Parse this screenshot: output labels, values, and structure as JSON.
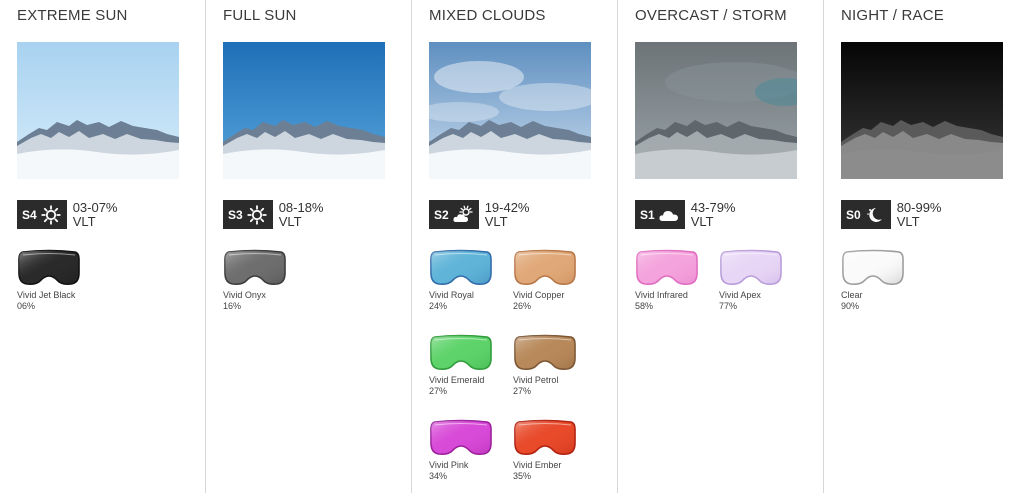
{
  "categories": [
    {
      "title": "EXTREME SUN",
      "code": "S4",
      "icon": "sun-icon",
      "vlt_range": "03-07%",
      "vlt_label": "VLT",
      "sky": [
        "#a8d2f0",
        "#d6ecfa"
      ],
      "lenses": [
        {
          "name": "Vivid Jet Black",
          "vlt": "06%",
          "color": "#2a2a2a",
          "edge": "#111111"
        }
      ]
    },
    {
      "title": "FULL SUN",
      "code": "S3",
      "icon": "sun-icon",
      "vlt_range": "08-18%",
      "vlt_label": "VLT",
      "sky": [
        "#1e6fb8",
        "#5aa6db"
      ],
      "lenses": [
        {
          "name": "Vivid Onyx",
          "vlt": "16%",
          "color": "#6e6e6e",
          "edge": "#3a3a3a"
        }
      ]
    },
    {
      "title": "MIXED CLOUDS",
      "code": "S2",
      "icon": "partly-cloudy-icon",
      "vlt_range": "19-42%",
      "vlt_label": "VLT",
      "sky": [
        "#5f8fc0",
        "#c9dcee"
      ],
      "lenses": [
        {
          "name": "Vivid Royal",
          "vlt": "24%",
          "color": "#5fb4d8",
          "edge": "#2f6aa8"
        },
        {
          "name": "Vivid Copper",
          "vlt": "26%",
          "color": "#e0a878",
          "edge": "#b77545"
        },
        {
          "name": "Vivid Emerald",
          "vlt": "27%",
          "color": "#5ed36a",
          "edge": "#2f9a3a"
        },
        {
          "name": "Vivid Petrol",
          "vlt": "27%",
          "color": "#b8895a",
          "edge": "#7a5533"
        },
        {
          "name": "Vivid Pink",
          "vlt": "34%",
          "color": "#d84ad8",
          "edge": "#9a1f9a"
        },
        {
          "name": "Vivid Ember",
          "vlt": "35%",
          "color": "#e84a2a",
          "edge": "#b02010"
        }
      ]
    },
    {
      "title": "OVERCAST / STORM",
      "code": "S1",
      "icon": "cloud-icon",
      "vlt_range": "43-79%",
      "vlt_label": "VLT",
      "sky": [
        "#6d7478",
        "#9aa4a8"
      ],
      "lenses": [
        {
          "name": "Vivid Infrared",
          "vlt": "58%",
          "color": "#f4a3dc",
          "edge": "#e06ac0"
        },
        {
          "name": "Vivid Apex",
          "vlt": "77%",
          "color": "#e8d6f6",
          "edge": "#b79ad8"
        }
      ]
    },
    {
      "title": "NIGHT / RACE",
      "code": "S0",
      "icon": "moon-icon",
      "vlt_range": "80-99%",
      "vlt_label": "VLT",
      "sky": [
        "#050505",
        "#3a3a3a"
      ],
      "lenses": [
        {
          "name": "Clear",
          "vlt": "90%",
          "color": "#fafafa",
          "edge": "#9a9a9a"
        }
      ]
    }
  ]
}
